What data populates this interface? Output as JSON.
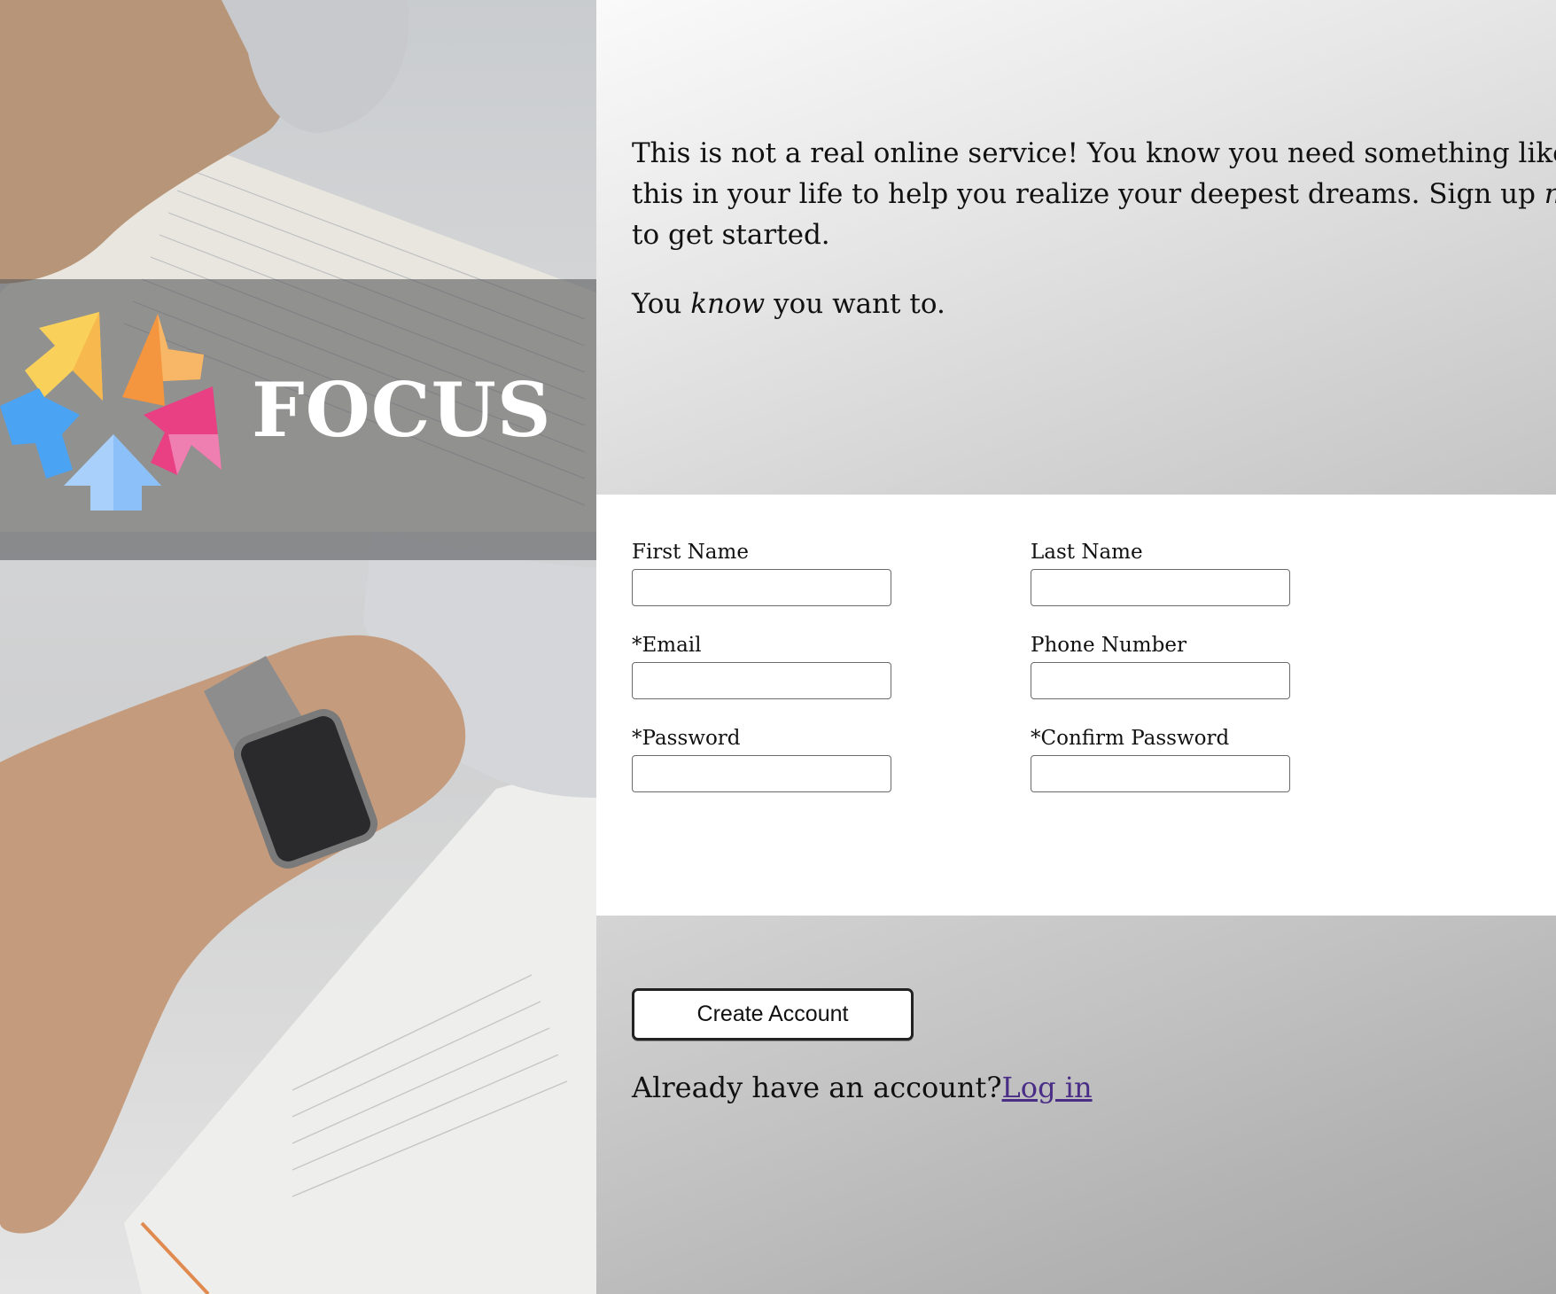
{
  "brand": {
    "name": "FOCUS",
    "colors": {
      "yellow": "#f9d15a",
      "orange": "#f4953f",
      "blue": "#4aa3f3",
      "light_blue": "#a8d0fb",
      "pink": "#e93f83"
    }
  },
  "intro": {
    "line1": "This is not a real online service! You know you need something like",
    "line2_before": "this in your life to help you realize your deepest dreams. Sign up ",
    "line2_emphasis": "now",
    "line3": "to get started.",
    "second_before": "You ",
    "second_emphasis": "know",
    "second_after": " you want to."
  },
  "form": {
    "first_name_label": "First Name",
    "last_name_label": "Last Name",
    "email_label": "*Email",
    "phone_label": "Phone Number",
    "password_label": "*Password",
    "confirm_password_label": "*Confirm Password",
    "first_name_value": "",
    "last_name_value": "",
    "email_value": "",
    "phone_value": "",
    "password_value": "",
    "confirm_password_value": ""
  },
  "actions": {
    "create_account_label": "Create Account",
    "have_account_text": "Already have an account?",
    "login_link_label": "Log in"
  }
}
